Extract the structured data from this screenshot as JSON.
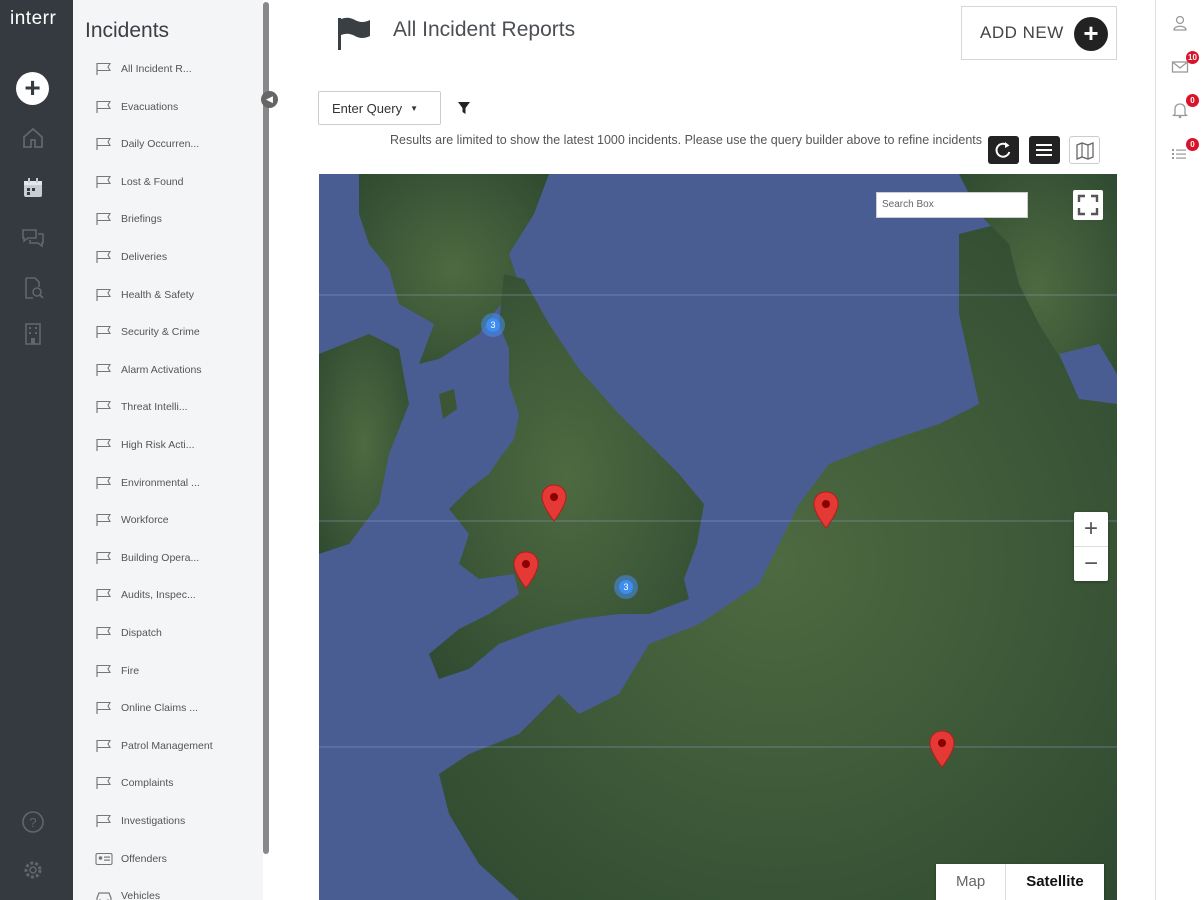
{
  "app": {
    "brand": "interr"
  },
  "rail": {
    "icons": [
      "add-icon",
      "home-icon",
      "calendar-icon",
      "chat-icon",
      "search-document-icon",
      "building-icon",
      "help-icon",
      "settings-icon"
    ]
  },
  "sidebar": {
    "title": "Incidents",
    "items": [
      {
        "label": "All Incident R...",
        "icon": "flag-outline-icon"
      },
      {
        "label": "Evacuations",
        "icon": "flag-outline-icon"
      },
      {
        "label": "Daily Occurren...",
        "icon": "flag-outline-icon"
      },
      {
        "label": "Lost & Found",
        "icon": "flag-outline-icon"
      },
      {
        "label": "Briefings",
        "icon": "flag-outline-icon"
      },
      {
        "label": "Deliveries",
        "icon": "flag-outline-icon"
      },
      {
        "label": "Health & Safety",
        "icon": "flag-outline-icon"
      },
      {
        "label": "Security & Crime",
        "icon": "flag-outline-icon"
      },
      {
        "label": "Alarm Activations",
        "icon": "flag-outline-icon"
      },
      {
        "label": "Threat Intelli...",
        "icon": "flag-outline-icon"
      },
      {
        "label": "High Risk Acti...",
        "icon": "flag-outline-icon"
      },
      {
        "label": "Environmental ...",
        "icon": "flag-outline-icon"
      },
      {
        "label": "Workforce",
        "icon": "flag-outline-icon"
      },
      {
        "label": "Building Opera...",
        "icon": "flag-outline-icon"
      },
      {
        "label": "Audits, Inspec...",
        "icon": "flag-outline-icon"
      },
      {
        "label": "Dispatch",
        "icon": "flag-outline-icon"
      },
      {
        "label": "Fire",
        "icon": "flag-outline-icon"
      },
      {
        "label": "Online Claims ...",
        "icon": "flag-outline-icon"
      },
      {
        "label": "Patrol Management",
        "icon": "flag-outline-icon"
      },
      {
        "label": "Complaints",
        "icon": "flag-outline-icon"
      },
      {
        "label": "Investigations",
        "icon": "flag-outline-icon"
      },
      {
        "label": "Offenders",
        "icon": "id-card-icon"
      },
      {
        "label": "Vehicles",
        "icon": "car-icon"
      }
    ]
  },
  "header": {
    "title": "All Incident Reports",
    "add_new_label": "ADD NEW"
  },
  "query": {
    "label": "Enter Query",
    "notice": "Results are limited to show the latest 1000 incidents. Please use the query builder above to refine incidents"
  },
  "map": {
    "search_placeholder": "Search Box",
    "zoom_in": "+",
    "zoom_out": "−",
    "type_map": "Map",
    "type_satellite": "Satellite",
    "selected_type": "Satellite",
    "clusters": [
      {
        "count": "3"
      },
      {
        "count": "3"
      }
    ],
    "pin_count": 4
  },
  "right_rail": {
    "icons": [
      "user-icon",
      "mail-icon",
      "bell-icon",
      "list-icon"
    ],
    "badges": [
      "10",
      "0",
      "0"
    ]
  },
  "colors": {
    "rail": "#343a40",
    "sidebar_bg": "#f4f5f7",
    "badge": "#d9142a",
    "pin": "#e53935",
    "cluster": "#3d8ef0",
    "sea": "#4a5d93",
    "land": "#3e5a3a"
  }
}
